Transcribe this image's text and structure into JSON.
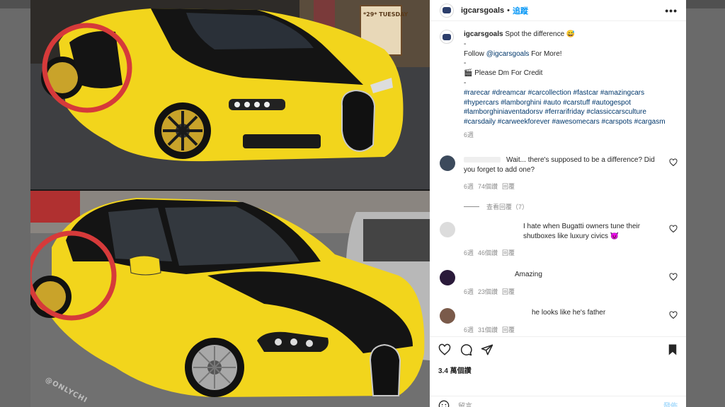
{
  "post": {
    "username": "igcarsgoals",
    "separator": "•",
    "follow_label": "追蹤",
    "more_label": "•••"
  },
  "caption": {
    "username": "igcarsgoals",
    "text": "Spot the difference 😅",
    "dash1": "-",
    "follow_prefix": "Follow ",
    "mention": "@igcarsgoals",
    "follow_suffix": " For More!",
    "dash2": "-",
    "credit": "🎬 Please Dm For Credit",
    "dash3": "-",
    "hashtags": "#rarecar #dreamcar #carcollection #fastcar #amazingcars #hypercars #lamborghini #auto #carstuff #autogespot #lamborghiniaventadorsv #ferrarifriday #classiccarsculture #carsdaily #carweekforever #awesomecars #carspots #cargasm",
    "time": "6週"
  },
  "comments": [
    {
      "text": "Wait... there's supposed to be a difference? Did you forget to add one?",
      "time": "6週",
      "likes": "74個讚",
      "reply": "回覆",
      "avatar_color": "#3c4a5c"
    },
    {
      "text": "I hate when Bugatti owners tune their shutboxes like luxury civics 😈",
      "time": "6週",
      "likes": "46個讚",
      "reply": "回覆",
      "avatar_color": "#dcdcdc"
    },
    {
      "text": "Amazing",
      "time": "6週",
      "likes": "23個讚",
      "reply": "回覆",
      "avatar_color": "#2a1a3a"
    },
    {
      "text": "he looks like he's father",
      "time": "6週",
      "likes": "31個讚",
      "reply": "回覆",
      "avatar_color": "#7a5a4a"
    }
  ],
  "view_replies": "查看回覆（7）",
  "actions": {
    "likes_count": "3.4 萬個讚",
    "time_ago": "",
    "add_comment_placeholder": "留言……",
    "post_label": "發佈"
  },
  "media": {
    "watermark": "@ONLYCHI",
    "sign_text": "*29* TUESDAY"
  },
  "colors": {
    "accent": "#0095f6",
    "car_yellow": "#f2d51c",
    "circle_red": "#d63a3a"
  }
}
